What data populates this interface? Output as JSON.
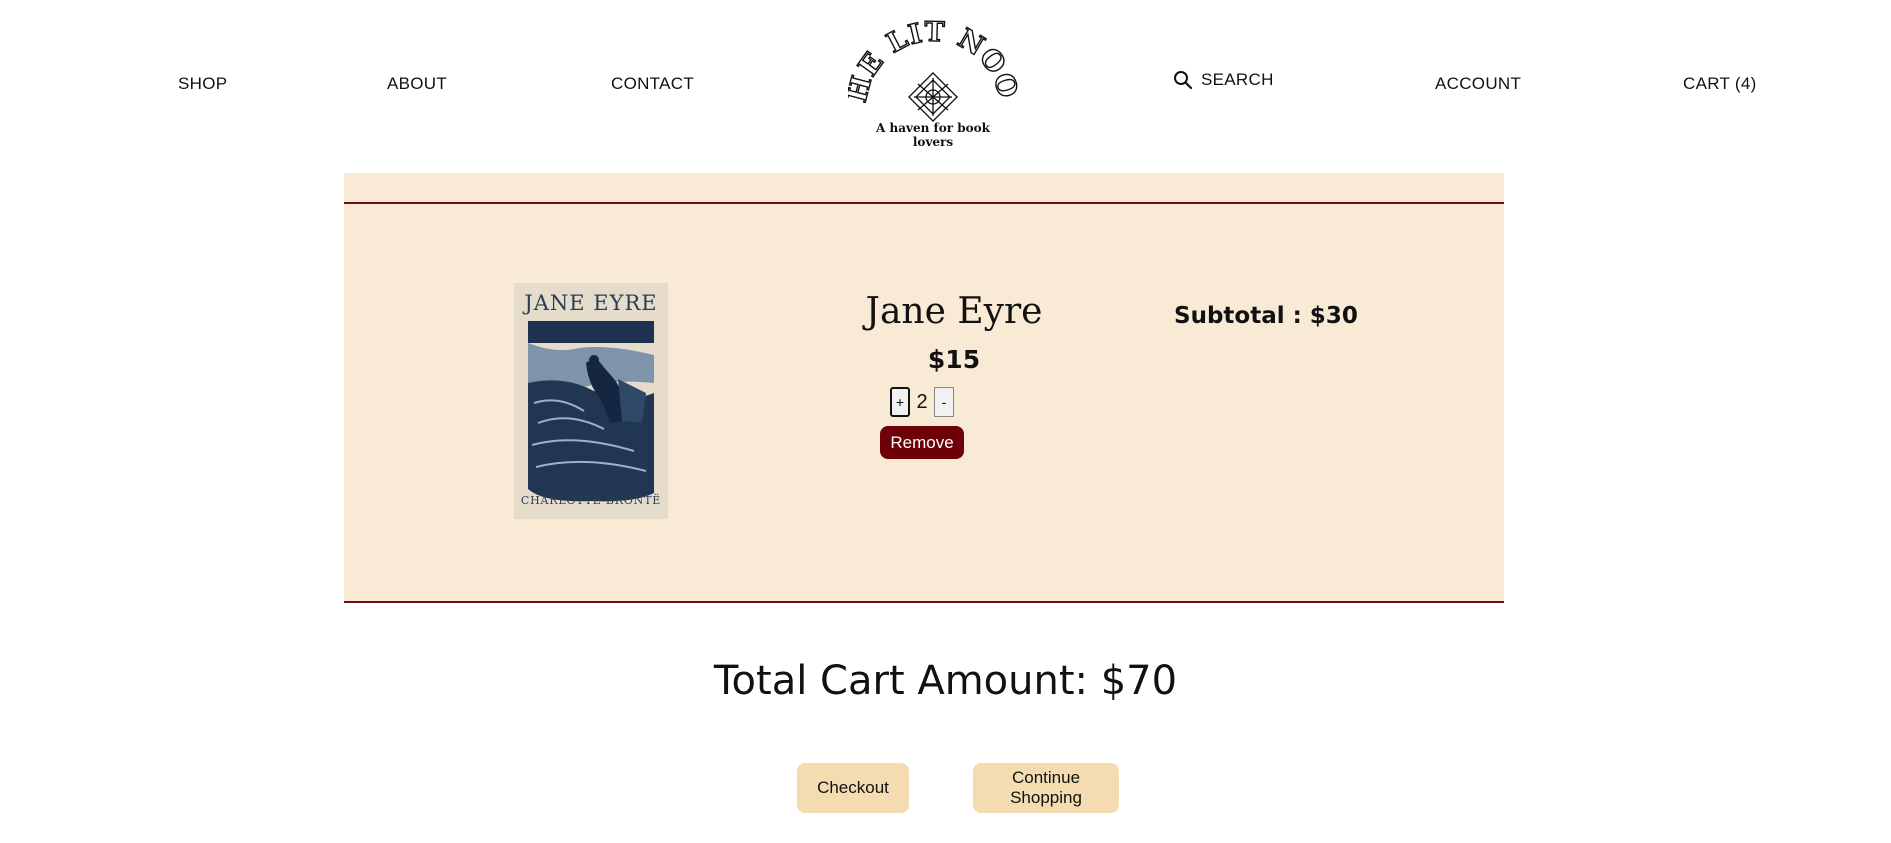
{
  "nav": {
    "shop": "SHOP",
    "about": "ABOUT",
    "contact": "CONTACT",
    "search": "SEARCH",
    "account": "ACCOUNT",
    "cart": "CART (4)"
  },
  "logo": {
    "name": "THE LIT NOOK",
    "tagline": "A haven for book lovers"
  },
  "cart_item": {
    "cover_title": "JANE EYRE",
    "cover_author": "CHARLOTTE BRONTË",
    "title": "Jane Eyre",
    "price": "$15",
    "plus_label": "+",
    "quantity": "2",
    "minus_label": "-",
    "remove_label": "Remove",
    "subtotal": "Subtotal : $30"
  },
  "total": "Total Cart Amount: $70",
  "actions": {
    "checkout": "Checkout",
    "continue": "Continue Shopping"
  },
  "colors": {
    "panel_bg": "#f9ead6",
    "accent": "#6e0008",
    "button_bg": "#f4dcb0"
  }
}
